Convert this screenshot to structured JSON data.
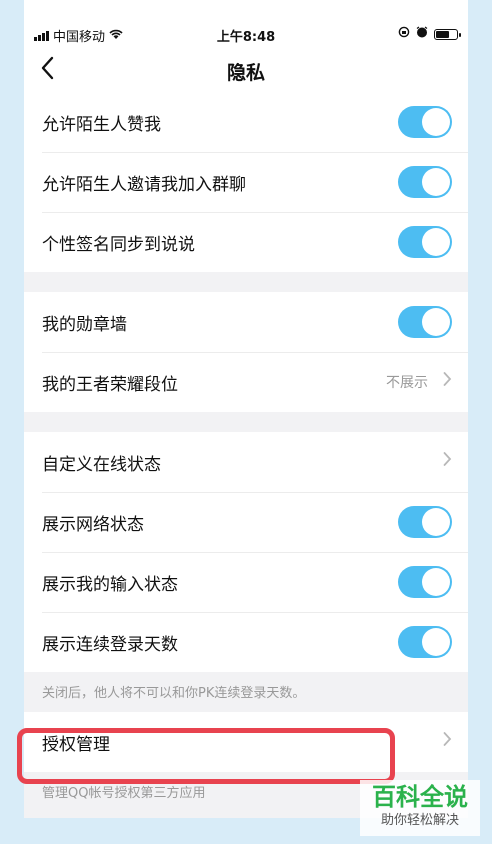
{
  "status": {
    "carrier": "中国移动",
    "time": "上午8:48",
    "icons": [
      "signal-icon",
      "wifi-icon",
      "rotation-lock-icon",
      "alarm-icon",
      "battery-icon"
    ]
  },
  "nav": {
    "title": "隐私",
    "back_icon": "chevron-left-icon"
  },
  "group1": [
    {
      "label": "允许陌生人赞我",
      "toggle": true
    },
    {
      "label": "允许陌生人邀请我加入群聊",
      "toggle": true
    },
    {
      "label": "个性签名同步到说说",
      "toggle": true
    }
  ],
  "group2": [
    {
      "label": "我的勋章墙",
      "toggle": true
    },
    {
      "label": "我的王者荣耀段位",
      "value": "不展示"
    }
  ],
  "group3": [
    {
      "label": "自定义在线状态"
    },
    {
      "label": "展示网络状态",
      "toggle": true
    },
    {
      "label": "展示我的输入状态",
      "toggle": true
    },
    {
      "label": "展示连续登录天数",
      "toggle": true
    }
  ],
  "note1": "关闭后，他人将不可以和你PK连续登录天数。",
  "auth": {
    "label": "授权管理"
  },
  "note2": "管理QQ帐号授权第三方应用",
  "watermark": {
    "main": "百科全说",
    "sub": "助你轻松解决"
  },
  "colors": {
    "toggle_on": "#4dbdf2",
    "highlight": "#e8434f",
    "watermark_green": "#2bb24c"
  }
}
